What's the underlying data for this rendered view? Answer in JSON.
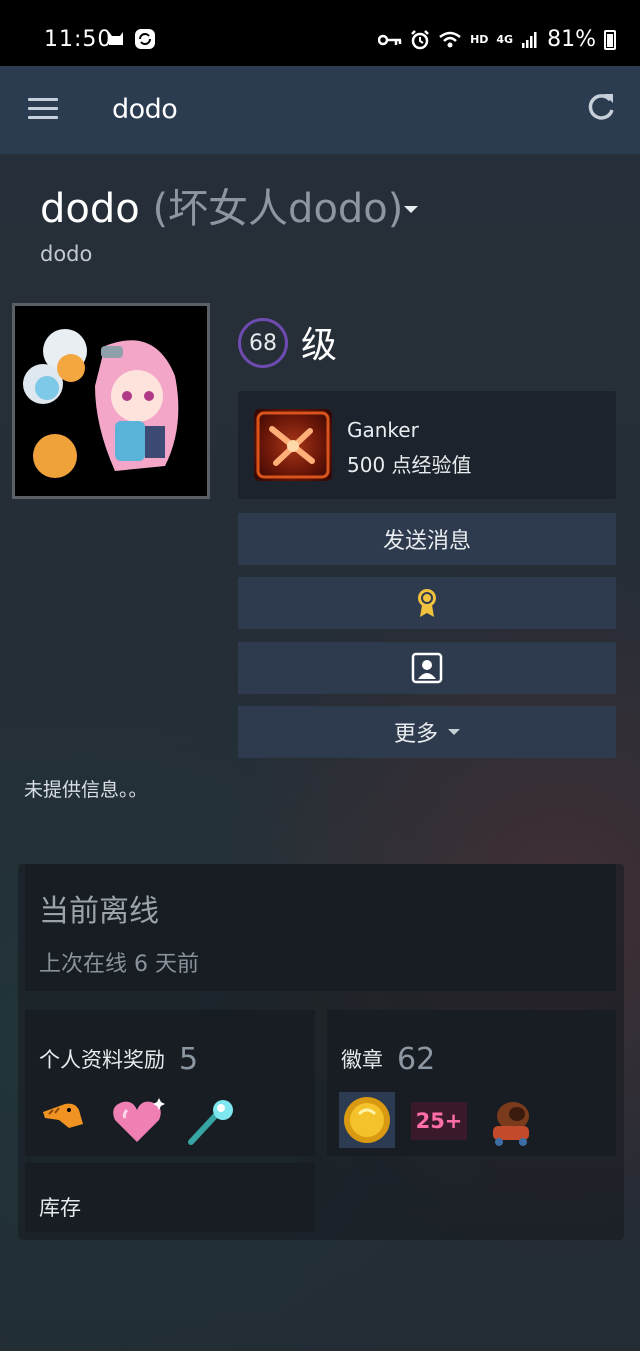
{
  "status_bar": {
    "time": "11:50",
    "left_icons": [
      "cat-icon",
      "sync-icon"
    ],
    "right_icons": [
      "key-icon",
      "alarm-icon",
      "wifi-icon",
      "hd-icon",
      "4g-signal-icon",
      "battery-icon"
    ],
    "hd_label": "HD",
    "network_label": "4G",
    "battery": "81%"
  },
  "app_bar": {
    "title": "dodo"
  },
  "profile": {
    "name": "dodo",
    "alias": "(坏女人dodo)",
    "subtitle": "dodo",
    "level": "68",
    "level_label": "级",
    "featured_badge": {
      "name": "Ganker",
      "xp": "500 点经验值"
    },
    "summary": "未提供信息。。"
  },
  "actions": {
    "send_message": "发送消息",
    "award_icon": "award-ribbon-icon",
    "profile_icon": "profile-card-icon",
    "more": "更多"
  },
  "status": {
    "title": "当前离线",
    "last_online": "上次在线 6 天前"
  },
  "rewards": {
    "label": "个人资料奖励",
    "count": "5",
    "items": [
      "dinosaur-sticker-icon",
      "sparkle-heart-icon",
      "comet-icon"
    ]
  },
  "badges": {
    "label": "徽章",
    "count": "62",
    "items": [
      "gold-coin-badge-icon",
      "years-25-plus-badge-icon",
      "cannon-badge-icon"
    ],
    "years_label": "25+"
  },
  "inventory": {
    "label": "库存"
  },
  "colors": {
    "app_bar": "#2b3b50",
    "button": "#2e3a4d",
    "level_ring": "#6e4bb0",
    "card": "#171d22"
  }
}
